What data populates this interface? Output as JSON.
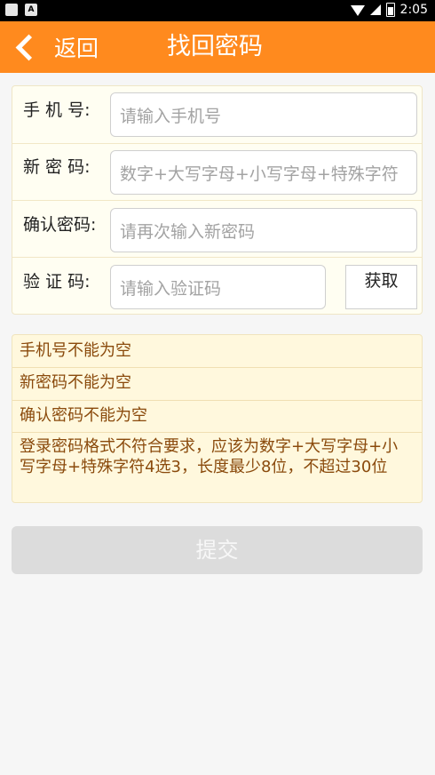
{
  "statusbar": {
    "time": "2:05",
    "notif_letter": "A"
  },
  "header": {
    "back_label": "返回",
    "title": "找回密码"
  },
  "form": {
    "phone": {
      "label": "手 机 号:",
      "placeholder": "请输入手机号"
    },
    "new_password": {
      "label": "新 密 码:",
      "placeholder": "数字+大写字母+小写字母+特殊字符"
    },
    "confirm_password": {
      "label": "确认密码:",
      "placeholder": "请再次输入新密码"
    },
    "captcha": {
      "label": "验 证 码:",
      "placeholder": "请输入验证码",
      "get_button": "获取"
    }
  },
  "errors": [
    "手机号不能为空",
    "新密码不能为空",
    "确认密码不能为空",
    "登录密码格式不符合要求，应该为数字+大写字母+小写字母+特殊字符4选3，长度最少8位，不超过30位"
  ],
  "submit_label": "提交",
  "colors": {
    "accent": "#ff8a1e",
    "error_text": "#8a4a0c",
    "disabled_button": "#dcdcdc"
  }
}
